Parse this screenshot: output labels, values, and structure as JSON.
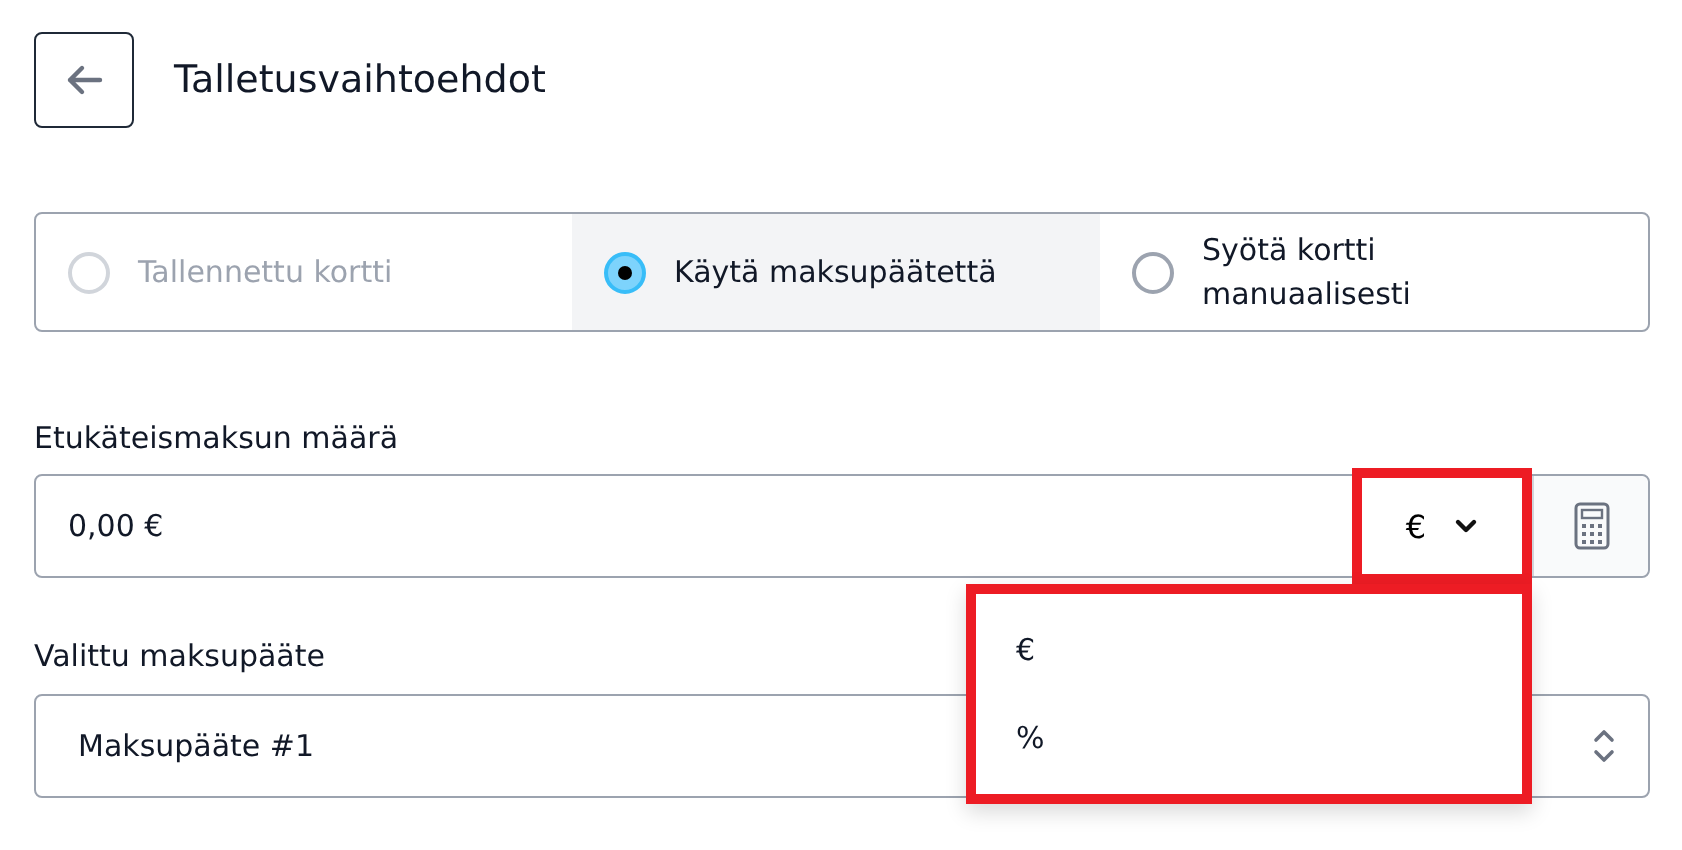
{
  "header": {
    "title": "Talletusvaihtoehdot"
  },
  "payment_options": [
    {
      "label": "Tallennettu kortti",
      "selected": false,
      "disabled": true
    },
    {
      "label": "Käytä maksupäätettä",
      "selected": true,
      "disabled": false
    },
    {
      "label": "Syötä kortti manuaalisesti",
      "selected": false,
      "disabled": false
    }
  ],
  "deposit": {
    "label": "Etukäteismaksun määrä",
    "value": "0,00 €",
    "unit": {
      "value": "€",
      "highlighted": true
    },
    "unit_menu": {
      "open": true,
      "highlighted": true,
      "items": [
        "€",
        "%"
      ]
    }
  },
  "terminal": {
    "label": "Valittu maksupääte",
    "value": "Maksupääte #1"
  }
}
